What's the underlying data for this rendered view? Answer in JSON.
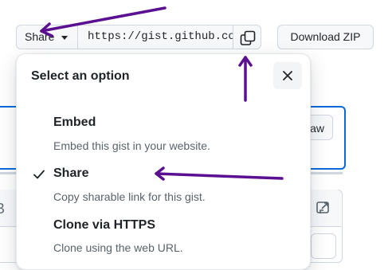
{
  "toolbar": {
    "share_label": "Share",
    "url_value": "https://gist.github.com/",
    "download_label": "Download ZIP"
  },
  "background": {
    "raw_label": "Raw",
    "left_char": "B"
  },
  "menu": {
    "title": "Select an option",
    "options": [
      {
        "label": "Embed",
        "description": "Embed this gist in your website.",
        "selected": false
      },
      {
        "label": "Share",
        "description": "Copy sharable link for this gist.",
        "selected": true
      },
      {
        "label": "Clone via HTTPS",
        "description": "Clone using the web URL.",
        "selected": false
      }
    ]
  },
  "icons": {
    "copy": "copy-icon",
    "close": "close-icon",
    "check": "check-icon",
    "external": "link-external-icon",
    "caret": "triangle-down-icon"
  },
  "colors": {
    "focus_blue": "#0969da",
    "arrow_purple": "#5b0f91"
  }
}
